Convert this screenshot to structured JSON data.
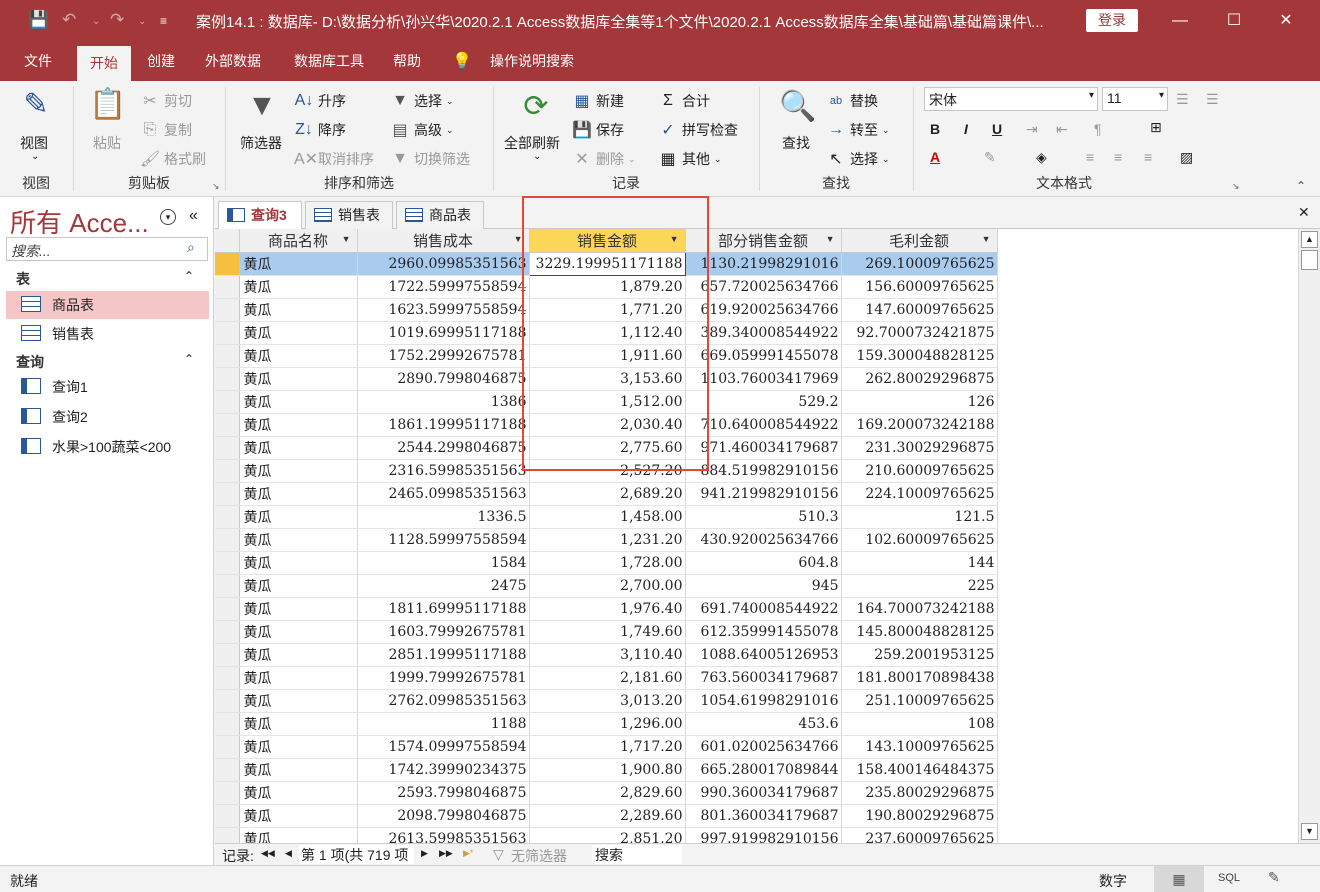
{
  "titlebar": {
    "title": "案例14.1 : 数据库- D:\\数据分析\\孙兴华\\2020.2.1 Access数据库全集等1个文件\\2020.2.1 Access数据库全集\\基础篇\\基础篇课件\\...",
    "login": "登录",
    "minimize": "—",
    "restore": "☐",
    "close": "✕"
  },
  "ribbon_tabs": [
    "文件",
    "开始",
    "创建",
    "外部数据",
    "数据库工具",
    "帮助",
    "操作说明搜索"
  ],
  "ribbon": {
    "view": {
      "button": "视图",
      "group": "视图"
    },
    "clipboard": {
      "paste": "粘贴",
      "cut": "剪切",
      "copy": "复制",
      "format_painter": "格式刷",
      "group": "剪贴板"
    },
    "sort_filter": {
      "filter": "筛选器",
      "ascending": "升序",
      "descending": "降序",
      "remove_sort": "取消排序",
      "selection": "选择",
      "advanced": "高级",
      "toggle_filter": "切换筛选",
      "group": "排序和筛选"
    },
    "records": {
      "refresh_all": "全部刷新",
      "new": "新建",
      "save": "保存",
      "delete": "删除",
      "totals": "合计",
      "spelling": "拼写检查",
      "more": "其他",
      "group": "记录"
    },
    "find": {
      "find": "查找",
      "replace": "替换",
      "goto": "转至",
      "select": "选择",
      "group": "查找"
    },
    "text_format": {
      "font": "宋体",
      "size": "11",
      "bold": "B",
      "italic": "I",
      "underline": "U",
      "group": "文本格式"
    }
  },
  "nav": {
    "title": "所有 Acce...",
    "search_placeholder": "搜索...",
    "sec_tables": "表",
    "tables": [
      "商品表",
      "销售表"
    ],
    "sec_queries": "查询",
    "queries": [
      "查询1",
      "查询2",
      "水果>100蔬菜<200"
    ]
  },
  "doc_tabs": [
    "查询3",
    "销售表",
    "商品表"
  ],
  "grid": {
    "columns": [
      "商品名称",
      "销售成本",
      "销售金额",
      "部分销售金额",
      "毛利金额"
    ],
    "rows": [
      [
        "黄瓜",
        "2960.09985351563",
        "3229.199951171188",
        "1130.21998291016",
        "269.10009765625"
      ],
      [
        "黄瓜",
        "1722.59997558594",
        "1,879.20",
        "657.720025634766",
        "156.60009765625"
      ],
      [
        "黄瓜",
        "1623.59997558594",
        "1,771.20",
        "619.920025634766",
        "147.60009765625"
      ],
      [
        "黄瓜",
        "1019.69995117188",
        "1,112.40",
        "389.340008544922",
        "92.7000732421875"
      ],
      [
        "黄瓜",
        "1752.29992675781",
        "1,911.60",
        "669.059991455078",
        "159.300048828125"
      ],
      [
        "黄瓜",
        "2890.7998046875",
        "3,153.60",
        "1103.76003417969",
        "262.80029296875"
      ],
      [
        "黄瓜",
        "1386",
        "1,512.00",
        "529.2",
        "126"
      ],
      [
        "黄瓜",
        "1861.19995117188",
        "2,030.40",
        "710.640008544922",
        "169.200073242188"
      ],
      [
        "黄瓜",
        "2544.2998046875",
        "2,775.60",
        "971.460034179687",
        "231.30029296875"
      ],
      [
        "黄瓜",
        "2316.59985351563",
        "2,527.20",
        "884.519982910156",
        "210.60009765625"
      ],
      [
        "黄瓜",
        "2465.09985351563",
        "2,689.20",
        "941.219982910156",
        "224.10009765625"
      ],
      [
        "黄瓜",
        "1336.5",
        "1,458.00",
        "510.3",
        "121.5"
      ],
      [
        "黄瓜",
        "1128.59997558594",
        "1,231.20",
        "430.920025634766",
        "102.60009765625"
      ],
      [
        "黄瓜",
        "1584",
        "1,728.00",
        "604.8",
        "144"
      ],
      [
        "黄瓜",
        "2475",
        "2,700.00",
        "945",
        "225"
      ],
      [
        "黄瓜",
        "1811.69995117188",
        "1,976.40",
        "691.740008544922",
        "164.700073242188"
      ],
      [
        "黄瓜",
        "1603.79992675781",
        "1,749.60",
        "612.359991455078",
        "145.800048828125"
      ],
      [
        "黄瓜",
        "2851.19995117188",
        "3,110.40",
        "1088.64005126953",
        "259.2001953125"
      ],
      [
        "黄瓜",
        "1999.79992675781",
        "2,181.60",
        "763.560034179687",
        "181.800170898438"
      ],
      [
        "黄瓜",
        "2762.09985351563",
        "3,013.20",
        "1054.61998291016",
        "251.10009765625"
      ],
      [
        "黄瓜",
        "1188",
        "1,296.00",
        "453.6",
        "108"
      ],
      [
        "黄瓜",
        "1574.09997558594",
        "1,717.20",
        "601.020025634766",
        "143.10009765625"
      ],
      [
        "黄瓜",
        "1742.39990234375",
        "1,900.80",
        "665.280017089844",
        "158.400146484375"
      ],
      [
        "黄瓜",
        "2593.7998046875",
        "2,829.60",
        "990.360034179687",
        "235.80029296875"
      ],
      [
        "黄瓜",
        "2098.7998046875",
        "2,289.60",
        "801.360034179687",
        "190.80029296875"
      ],
      [
        "黄瓜",
        "2613.59985351563",
        "2,851.20",
        "997.919982910156",
        "237.60009765625"
      ]
    ]
  },
  "record_nav": {
    "label": "记录:",
    "first": "◀◀",
    "prev": "◀",
    "position": "第 1 项(共 719 项",
    "next": "▶",
    "last": "▶▶",
    "new": "▶*",
    "filter": "无筛选器",
    "search": "搜索"
  },
  "status": {
    "left": "就绪",
    "mode": "数字",
    "sql": "SQL"
  }
}
